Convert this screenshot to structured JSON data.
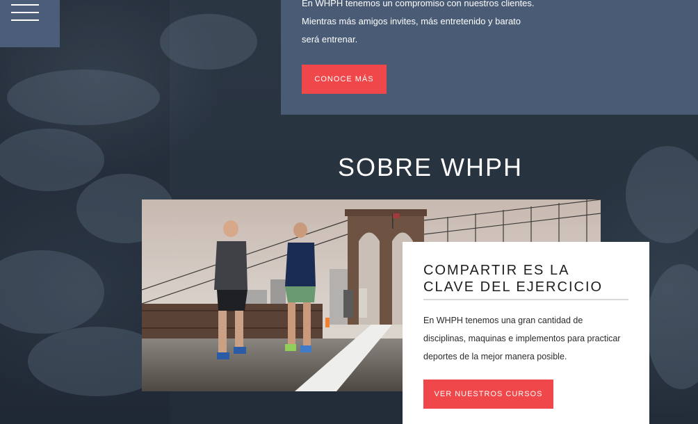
{
  "menu": {
    "icon": "hamburger-menu-icon"
  },
  "info_panel": {
    "lines": [
      "En WHPH tenemos un compromiso con nuestros clientes.",
      "Mientras más amigos invites, más entretenido y barato",
      "será entrenar."
    ],
    "button_label": "CONOCE MÁS"
  },
  "section": {
    "title": "SOBRE WHPH"
  },
  "photo": {
    "subject": "runners-on-bridge-photo"
  },
  "card": {
    "title_lines": [
      "COMPARTIR ES LA",
      "CLAVE DEL EJERCICIO"
    ],
    "text_lines": [
      "En WHPH tenemos una gran cantidad de",
      "disciplinas, maquinas e implementos para practicar",
      "deportes de la mejor manera posible."
    ],
    "button_label": "VER NUESTROS CURSOS"
  },
  "colors": {
    "accent": "#f0474a",
    "panel": "#4a5b76",
    "menu_bg": "#4b5d78",
    "background": "#283441",
    "card_bg": "#ffffff"
  }
}
